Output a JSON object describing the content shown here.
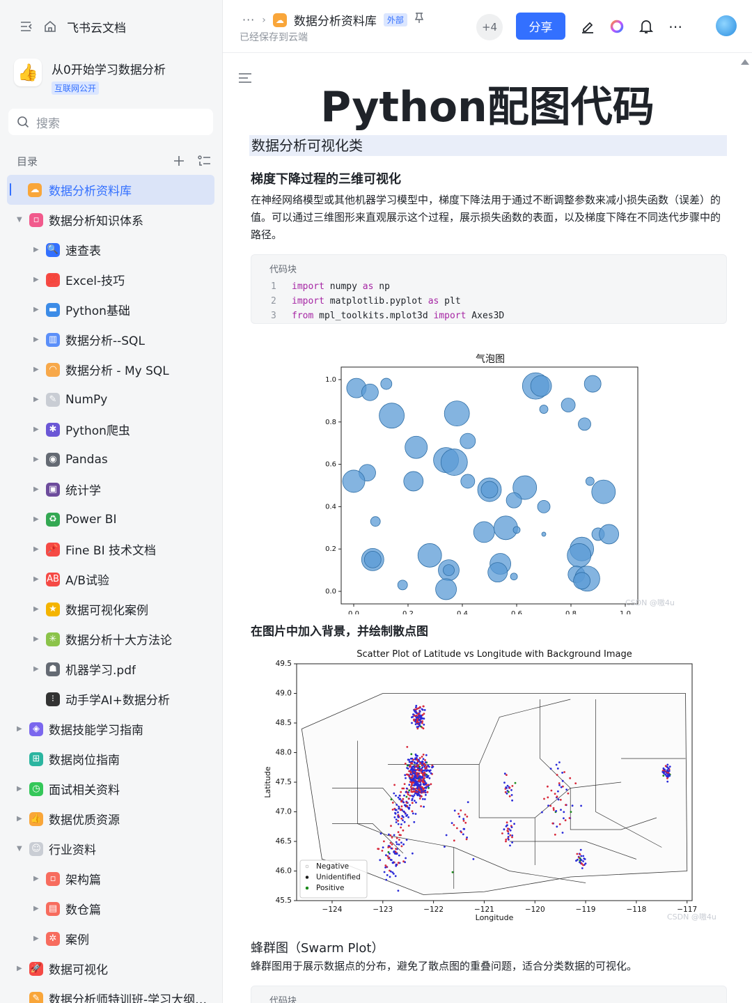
{
  "app": {
    "name": "飞书云文档"
  },
  "space": {
    "name": "从0开始学习数据分析",
    "tag": "互联网公开"
  },
  "search": {
    "placeholder": "搜索"
  },
  "toc": {
    "heading": "目录",
    "items": [
      {
        "label": "数据分析资料库",
        "level": 0,
        "active": true,
        "caret": "",
        "icon": "doc-lib-icon",
        "color": "#f9a63a",
        "glyph": "☁"
      },
      {
        "label": "数据分析知识体系",
        "level": 0,
        "caret": "▼",
        "icon": "folder-pink-icon",
        "color": "#f15a8c",
        "glyph": "▫"
      },
      {
        "label": "速查表",
        "level": 1,
        "caret": "▶",
        "icon": "magnifier-icon",
        "color": "#3370ff",
        "glyph": "🔍"
      },
      {
        "label": "Excel-技巧",
        "level": 1,
        "caret": "▶",
        "icon": "hundred-icon",
        "color": "#f54a45",
        "glyph": "💯"
      },
      {
        "label": "Python基础",
        "level": 1,
        "caret": "▶",
        "icon": "monitor-icon",
        "color": "#3c8ce7",
        "glyph": "▬"
      },
      {
        "label": "数据分析--SQL",
        "level": 1,
        "caret": "▶",
        "icon": "bar-chart-icon",
        "color": "#5b8ff9",
        "glyph": "▥"
      },
      {
        "label": "数据分析 - My SQL",
        "level": 1,
        "caret": "▶",
        "icon": "rainbow-icon",
        "color": "#f7a84a",
        "glyph": "◠"
      },
      {
        "label": "NumPy",
        "level": 1,
        "caret": "▶",
        "icon": "memo-icon",
        "color": "#c9cdd4",
        "glyph": "✎"
      },
      {
        "label": "Python爬虫",
        "level": 1,
        "caret": "▶",
        "icon": "spider-icon",
        "color": "#6b57d6",
        "glyph": "✱"
      },
      {
        "label": "Pandas",
        "level": 1,
        "caret": "▶",
        "icon": "panda-icon",
        "color": "#646a73",
        "glyph": "◉"
      },
      {
        "label": "统计学",
        "level": 1,
        "caret": "▶",
        "icon": "floppy-disk-icon",
        "color": "#6d4c9c",
        "glyph": "▣"
      },
      {
        "label": "Power BI",
        "level": 1,
        "caret": "▶",
        "icon": "recycle-icon",
        "color": "#34a853",
        "glyph": "♻"
      },
      {
        "label": "Fine BI 技术文档",
        "level": 1,
        "caret": "▶",
        "icon": "pushpin-icon",
        "color": "#f54a45",
        "glyph": "📌"
      },
      {
        "label": "A/B试验",
        "level": 1,
        "caret": "▶",
        "icon": "ab-icon",
        "color": "#f54a45",
        "glyph": "AB"
      },
      {
        "label": "数据可视化案例",
        "level": 1,
        "caret": "▶",
        "icon": "medal-icon",
        "color": "#f4b400",
        "glyph": "★"
      },
      {
        "label": "数据分析十大方法论",
        "level": 1,
        "caret": "▶",
        "icon": "sparkle-icon",
        "color": "#8bc34a",
        "glyph": "✳"
      },
      {
        "label": "机器学习.pdf",
        "level": 1,
        "caret": "▶",
        "icon": "robot-icon",
        "color": "#646a73",
        "glyph": "☗"
      },
      {
        "label": "动手学AI+数据分析",
        "level": 1,
        "caret": "",
        "icon": "traffic-light-icon",
        "color": "#333333",
        "glyph": "⁝"
      },
      {
        "label": "数据技能学习指南",
        "level": 0,
        "caret": "▶",
        "icon": "cube-icon",
        "color": "#7b67ee",
        "glyph": "◈"
      },
      {
        "label": "数据岗位指南",
        "level": 0,
        "caret": "",
        "icon": "grid-icon",
        "color": "#2bb5a0",
        "glyph": "⊞"
      },
      {
        "label": "面试相关资料",
        "level": 0,
        "caret": "▶",
        "icon": "clock-icon",
        "color": "#34c759",
        "glyph": "◷"
      },
      {
        "label": "数据优质资源",
        "level": 0,
        "caret": "▶",
        "icon": "thumbs-up-icon",
        "color": "#f9a63a",
        "glyph": "👍"
      },
      {
        "label": "行业资料",
        "level": 0,
        "caret": "▼",
        "icon": "ghost-icon",
        "color": "#c9cdd4",
        "glyph": "☺"
      },
      {
        "label": "架构篇",
        "level": 1,
        "caret": "▶",
        "icon": "coral-doc-icon",
        "color": "#f76c5e",
        "glyph": "▫"
      },
      {
        "label": "数仓篇",
        "level": 1,
        "caret": "▶",
        "icon": "coral-table-icon",
        "color": "#f76c5e",
        "glyph": "▤"
      },
      {
        "label": "案例",
        "level": 1,
        "caret": "▶",
        "icon": "coral-gear-icon",
        "color": "#f76c5e",
        "glyph": "✲"
      },
      {
        "label": "数据可视化",
        "level": 0,
        "caret": "▶",
        "icon": "rocket-icon",
        "color": "#f54a45",
        "glyph": "🚀"
      },
      {
        "label": "数据分析师特训班-学习大纲（...",
        "level": 0,
        "caret": "",
        "icon": "note-icon",
        "color": "#f9a63a",
        "glyph": "✎"
      }
    ]
  },
  "header": {
    "crumb_dots": "···",
    "doc_name": "数据分析资料库",
    "external_tag": "外部",
    "saved": "已经保存到云端",
    "collaborators": "+4",
    "share": "分享"
  },
  "doc": {
    "title": "Python配图代码",
    "h1": "数据分析可视化类",
    "section1": {
      "title": "梯度下降过程的三维可视化",
      "para": "在神经网络模型或其他机器学习模型中，梯度下降法用于通过不断调整参数来减小损失函数（误差）的值。可以通过三维图形来直观展示这个过程，展示损失函数的表面，以及梯度下降在不同迭代步骤中的路径。"
    },
    "code": {
      "title": "代码块",
      "lines": [
        {
          "n": "1",
          "a": "import",
          "b": " numpy ",
          "c": "as",
          "d": " np"
        },
        {
          "n": "2",
          "a": "import",
          "b": " matplotlib.pyplot ",
          "c": "as",
          "d": " plt"
        },
        {
          "n": "3",
          "a": "from",
          "b": " mpl_toolkits.mplot3d ",
          "c": "import",
          "d": " Axes3D"
        }
      ]
    },
    "section2": {
      "title": "在图片中加入背景，并绘制散点图"
    },
    "section3": {
      "title": "蜂群图（Swarm Plot）",
      "para": "蜂群图用于展示数据点的分布，避免了散点图的重叠问题，适合分类数据的可视化。",
      "code_title": "代码块"
    },
    "watermark1": "CSDN @嗷4u",
    "watermark2": "CSDN @嗷4u"
  },
  "chart_data": [
    {
      "type": "scatter",
      "title": "气泡图",
      "xlim": [
        0,
        1
      ],
      "ylim": [
        0,
        1
      ],
      "xticks": [
        "0.0",
        "0.2",
        "0.4",
        "0.6",
        "0.8",
        "1.0"
      ],
      "yticks": [
        "0.0",
        "0.2",
        "0.4",
        "0.6",
        "0.8",
        "1.0"
      ],
      "color": "#5b9bd5",
      "points": [
        {
          "x": 0.01,
          "y": 0.96,
          "s": 14
        },
        {
          "x": 0.06,
          "y": 0.94,
          "s": 12
        },
        {
          "x": 0.12,
          "y": 0.98,
          "s": 8
        },
        {
          "x": 0.67,
          "y": 0.97,
          "s": 19
        },
        {
          "x": 0.69,
          "y": 0.97,
          "s": 15
        },
        {
          "x": 0.88,
          "y": 0.98,
          "s": 12
        },
        {
          "x": 0.14,
          "y": 0.83,
          "s": 18
        },
        {
          "x": 0.38,
          "y": 0.84,
          "s": 18
        },
        {
          "x": 0.7,
          "y": 0.86,
          "s": 6
        },
        {
          "x": 0.79,
          "y": 0.88,
          "s": 10
        },
        {
          "x": 0.85,
          "y": 0.79,
          "s": 9
        },
        {
          "x": 0.23,
          "y": 0.68,
          "s": 16
        },
        {
          "x": 0.42,
          "y": 0.71,
          "s": 11
        },
        {
          "x": 0.34,
          "y": 0.62,
          "s": 18
        },
        {
          "x": 0.37,
          "y": 0.61,
          "s": 19
        },
        {
          "x": 0.05,
          "y": 0.56,
          "s": 12
        },
        {
          "x": 0.0,
          "y": 0.52,
          "s": 16
        },
        {
          "x": 0.22,
          "y": 0.52,
          "s": 14
        },
        {
          "x": 0.42,
          "y": 0.52,
          "s": 10
        },
        {
          "x": 0.5,
          "y": 0.48,
          "s": 17
        },
        {
          "x": 0.5,
          "y": 0.48,
          "s": 12
        },
        {
          "x": 0.63,
          "y": 0.49,
          "s": 17
        },
        {
          "x": 0.59,
          "y": 0.43,
          "s": 11
        },
        {
          "x": 0.7,
          "y": 0.4,
          "s": 9
        },
        {
          "x": 0.87,
          "y": 0.52,
          "s": 6
        },
        {
          "x": 0.92,
          "y": 0.47,
          "s": 17
        },
        {
          "x": 0.08,
          "y": 0.33,
          "s": 7
        },
        {
          "x": 0.48,
          "y": 0.28,
          "s": 15
        },
        {
          "x": 0.56,
          "y": 0.3,
          "s": 17
        },
        {
          "x": 0.6,
          "y": 0.29,
          "s": 5
        },
        {
          "x": 0.7,
          "y": 0.27,
          "s": 3
        },
        {
          "x": 0.9,
          "y": 0.27,
          "s": 9
        },
        {
          "x": 0.94,
          "y": 0.27,
          "s": 14
        },
        {
          "x": 0.07,
          "y": 0.15,
          "s": 16
        },
        {
          "x": 0.07,
          "y": 0.15,
          "s": 12
        },
        {
          "x": 0.28,
          "y": 0.17,
          "s": 17
        },
        {
          "x": 0.35,
          "y": 0.1,
          "s": 15
        },
        {
          "x": 0.35,
          "y": 0.1,
          "s": 8
        },
        {
          "x": 0.54,
          "y": 0.13,
          "s": 15
        },
        {
          "x": 0.53,
          "y": 0.09,
          "s": 14
        },
        {
          "x": 0.59,
          "y": 0.07,
          "s": 5
        },
        {
          "x": 0.18,
          "y": 0.03,
          "s": 7
        },
        {
          "x": 0.34,
          "y": 0.01,
          "s": 15
        },
        {
          "x": 0.84,
          "y": 0.2,
          "s": 17
        },
        {
          "x": 0.83,
          "y": 0.17,
          "s": 17
        },
        {
          "x": 0.82,
          "y": 0.08,
          "s": 12
        },
        {
          "x": 0.86,
          "y": 0.06,
          "s": 18
        },
        {
          "x": 0.84,
          "y": 0.05,
          "s": 12
        }
      ]
    },
    {
      "type": "scatter",
      "title": "Scatter Plot of Latitude vs Longitude with Background Image",
      "xlabel": "Longitude",
      "ylabel": "Latitude",
      "xlim": [
        -124.7,
        -116.9
      ],
      "ylim": [
        45.5,
        49.5
      ],
      "xticks": [
        "-124",
        "-123",
        "-122",
        "-121",
        "-120",
        "-119",
        "-118",
        "-117"
      ],
      "yticks": [
        "45.5",
        "46.0",
        "46.5",
        "47.0",
        "47.5",
        "48.0",
        "48.5",
        "49.0",
        "49.5"
      ],
      "legend": [
        {
          "name": "Negative",
          "color": "#ffffff"
        },
        {
          "name": "Unidentified",
          "color": "#1a1a1a"
        },
        {
          "name": "Positive",
          "color": "#1a8a1a"
        }
      ],
      "point_colors": [
        "#2a2ad8",
        "#d8283a",
        "#1a8a1a"
      ],
      "clusters": [
        {
          "lon": -122.3,
          "lat": 47.6,
          "spread": 0.35,
          "n": 420
        },
        {
          "lon": -122.3,
          "lat": 48.6,
          "spread": 0.18,
          "n": 120
        },
        {
          "lon": -122.6,
          "lat": 47.1,
          "spread": 0.35,
          "n": 90
        },
        {
          "lon": -122.8,
          "lat": 46.3,
          "spread": 0.45,
          "n": 80
        },
        {
          "lon": -117.4,
          "lat": 47.65,
          "spread": 0.12,
          "n": 50
        },
        {
          "lon": -120.5,
          "lat": 46.6,
          "spread": 0.2,
          "n": 25
        },
        {
          "lon": -119.1,
          "lat": 46.2,
          "spread": 0.15,
          "n": 25
        },
        {
          "lon": -120.5,
          "lat": 47.4,
          "spread": 0.2,
          "n": 20
        },
        {
          "lon": -119.5,
          "lat": 47.2,
          "spread": 0.6,
          "n": 50
        },
        {
          "lon": -121.5,
          "lat": 46.7,
          "spread": 0.6,
          "n": 25
        }
      ]
    }
  ]
}
